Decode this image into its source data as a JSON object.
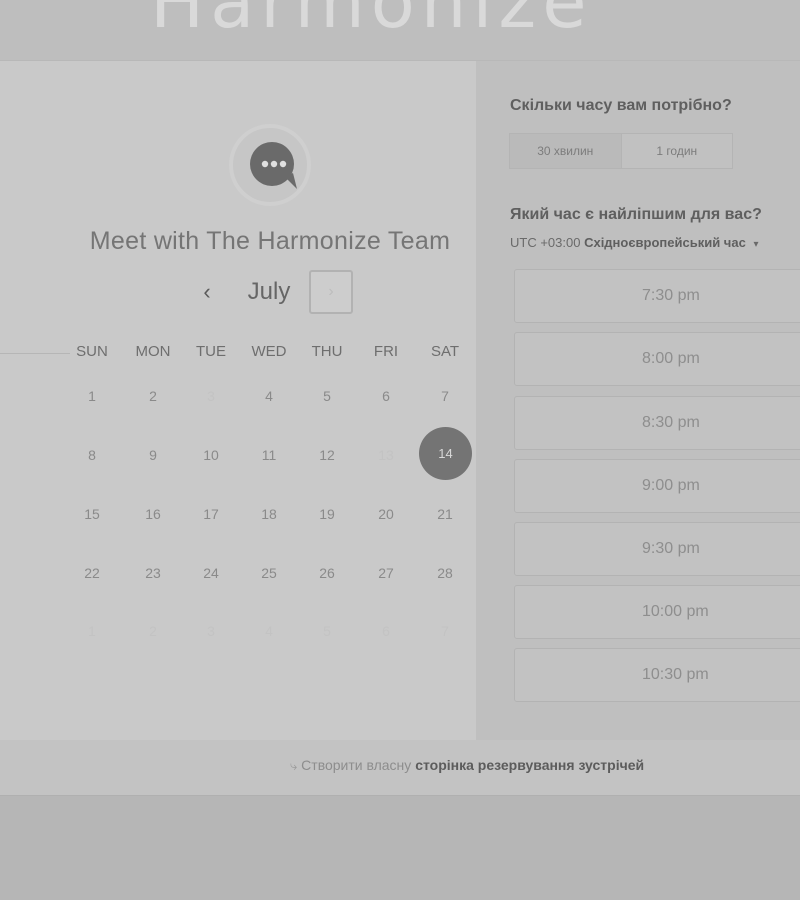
{
  "header": {
    "brand_text": "Harmonize"
  },
  "booking": {
    "title": "Meet with The Harmonize Team",
    "month": "July",
    "prev_icon": "‹",
    "next_icon": "›",
    "weekdays": [
      "SUN",
      "MON",
      "TUE",
      "WED",
      "THU",
      "FRI",
      "SAT"
    ],
    "weeks": [
      [
        "1",
        "2",
        "3",
        "4",
        "5",
        "6",
        "7"
      ],
      [
        "8",
        "9",
        "10",
        "11",
        "12",
        "13",
        "14"
      ],
      [
        "15",
        "16",
        "17",
        "18",
        "19",
        "20",
        "21"
      ],
      [
        "22",
        "23",
        "24",
        "25",
        "26",
        "27",
        "28"
      ],
      [
        "1",
        "2",
        "3",
        "4",
        "5",
        "6",
        "7"
      ]
    ],
    "selected_day": "14",
    "unavailable_days": [
      "3",
      "13"
    ]
  },
  "duration": {
    "question": "Скільки часу вам потрібно?",
    "options": [
      "30 хвилин",
      "1 годин"
    ],
    "selected": "30 хвилин"
  },
  "time": {
    "question": "Який час є найліпшим для вас?",
    "tz_offset": "UTC +03:00",
    "tz_name": "Східноєвропейський час",
    "slots": [
      "7:30 pm",
      "8:00 pm",
      "8:30 pm",
      "9:00 pm",
      "9:30 pm",
      "10:00 pm",
      "10:30 pm"
    ]
  },
  "footer": {
    "prefix": "Створити власну",
    "link": "сторінка резервування зустрічей"
  },
  "colors": {
    "selected_day": "#747474",
    "panel": "#c9c9c9"
  }
}
